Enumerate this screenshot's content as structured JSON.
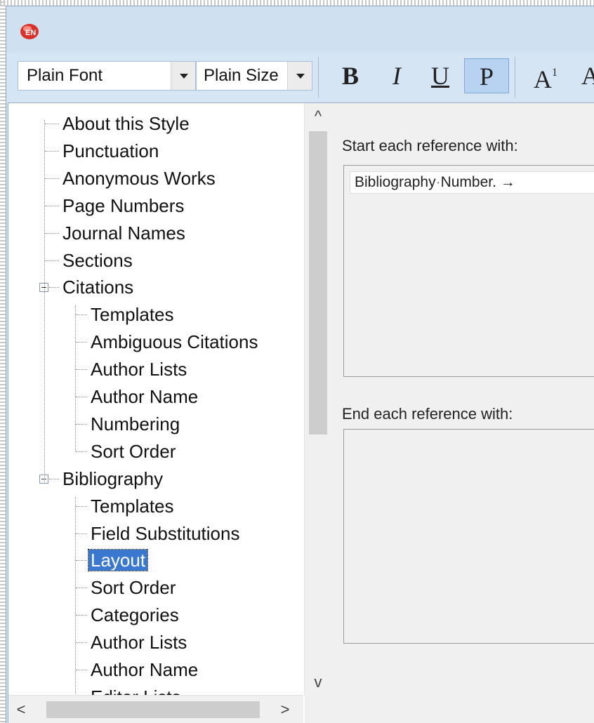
{
  "toolbar": {
    "font_combo": "Plain Font",
    "size_combo": "Plain Size",
    "bold_label": "B",
    "italic_label": "I",
    "underline_label": "U",
    "plain_label": "P",
    "superscript_label": "A",
    "superscript_mark": "1",
    "subscript_label": "A"
  },
  "tree": {
    "items": [
      {
        "label": "About this Style"
      },
      {
        "label": "Punctuation"
      },
      {
        "label": "Anonymous Works"
      },
      {
        "label": "Page Numbers"
      },
      {
        "label": "Journal Names"
      },
      {
        "label": "Sections"
      },
      {
        "label": "Citations"
      },
      {
        "label": "Templates"
      },
      {
        "label": "Ambiguous Citations"
      },
      {
        "label": "Author Lists"
      },
      {
        "label": "Author Name"
      },
      {
        "label": "Numbering"
      },
      {
        "label": "Sort Order"
      },
      {
        "label": "Bibliography"
      },
      {
        "label": "Templates"
      },
      {
        "label": "Field Substitutions"
      },
      {
        "label": "Layout",
        "selected": true
      },
      {
        "label": "Sort Order"
      },
      {
        "label": "Categories"
      },
      {
        "label": "Author Lists"
      },
      {
        "label": "Author Name"
      },
      {
        "label": "Editor Lists"
      }
    ],
    "scroll_up": "^",
    "scroll_down": "v",
    "scroll_left": "<",
    "scroll_right": ">"
  },
  "content": {
    "start_label": "Start each reference with:",
    "start_value": {
      "part1": "Bibliography",
      "part2": "Number",
      "end": ".",
      "tab_mark": "→"
    },
    "end_label": "End each reference with:",
    "end_value": ""
  }
}
